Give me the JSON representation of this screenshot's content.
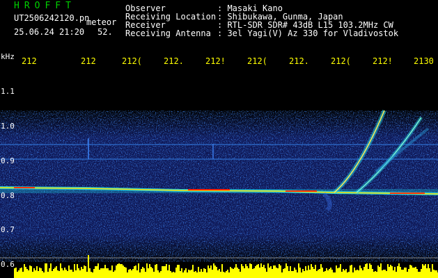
{
  "app_title": "HROFFT",
  "file_name": "UT2506242120.pn",
  "detection_label": "meteor",
  "date_time": "25.06.24 21:20",
  "count": "52.",
  "info": [
    {
      "label": "Observer",
      "value": ": Masaki Kano"
    },
    {
      "label": "Receiving Location",
      "value": ": Shibukawa, Gunma, Japan"
    },
    {
      "label": "Receiver",
      "value": ": RTL-SDR SDR# 43dB L15 103.2MHz CW"
    },
    {
      "label": "Receiving Antenna",
      "value": ": 3el Yagi(V) Az 330 for Vladivostok"
    }
  ],
  "freq_unit": "kHz",
  "freq_ticks": [
    "1.1",
    "1.0",
    "0.9",
    "0.8",
    "0.7",
    "0.6"
  ],
  "time_ticks": [
    "212",
    "212",
    "212(",
    "212.",
    "212!",
    "212(",
    "212.",
    "212(",
    "212!",
    "2130"
  ],
  "colors": {
    "title": "#00d000",
    "time_ticks": "#ffff00",
    "text": "#ffffff",
    "background": "#000000"
  }
}
